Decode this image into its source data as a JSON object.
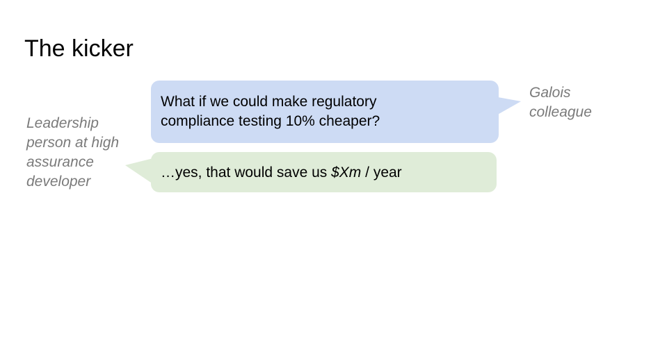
{
  "slide": {
    "title": "The kicker"
  },
  "speakers": {
    "left": {
      "lines": [
        "Leadership",
        "person at high",
        "assurance",
        "developer"
      ]
    },
    "right": {
      "lines": [
        "Galois",
        "colleague"
      ]
    }
  },
  "dialogue": {
    "question": {
      "lines": [
        "What if we could make regulatory",
        "compliance testing 10% cheaper?"
      ]
    },
    "answer": {
      "prefix": "…yes, that would save us ",
      "emphasis": "$Xm",
      "suffix": " / year"
    }
  },
  "colors": {
    "question_bubble": "#cddbf4",
    "answer_bubble": "#dfecd8",
    "speaker_label": "#7a7a7a"
  }
}
